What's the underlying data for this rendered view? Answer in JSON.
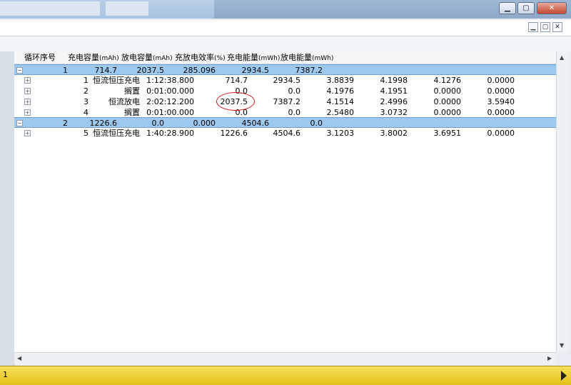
{
  "header": {
    "cycle": "循环序号",
    "charge_cap": "充电容量",
    "charge_cap_unit": "(mAh)",
    "discharge_cap": "放电容量",
    "discharge_cap_unit": "(mAh)",
    "efficiency": "充放电效率",
    "efficiency_unit": "(%)",
    "charge_energy": "充电能量",
    "charge_energy_unit": "(mWh)",
    "discharge_energy": "放电能量",
    "discharge_energy_unit": "(mWh)"
  },
  "groups": [
    {
      "expander": "−",
      "cycle": "1",
      "charge_cap": "714.7",
      "discharge_cap": "2037.5",
      "efficiency": "285.096",
      "charge_energy": "2934.5",
      "discharge_energy": "7387.2",
      "steps": [
        {
          "step": "1",
          "name": "恒流恒压充电",
          "time": "1:12:38.800",
          "v1": "714.7",
          "v2": "2934.5",
          "v3": "3.8839",
          "v4": "4.1998",
          "v5": "4.1276",
          "v6": "0.0000"
        },
        {
          "step": "2",
          "name": "搁置",
          "time": "0:01:00.000",
          "v1": "0.0",
          "v2": "0.0",
          "v3": "4.1976",
          "v4": "4.1951",
          "v5": "0.0000",
          "v6": "0.0000"
        },
        {
          "step": "3",
          "name": "恒流放电",
          "time": "2:02:12.200",
          "v1": "2037.5",
          "v2": "7387.2",
          "v3": "4.1514",
          "v4": "2.4996",
          "v5": "0.0000",
          "v6": "3.5940"
        },
        {
          "step": "4",
          "name": "搁置",
          "time": "0:01:00.000",
          "v1": "0.0",
          "v2": "0.0",
          "v3": "2.5480",
          "v4": "3.0732",
          "v5": "0.0000",
          "v6": "0.0000"
        }
      ]
    },
    {
      "expander": "−",
      "cycle": "2",
      "charge_cap": "1226.6",
      "discharge_cap": "0.0",
      "efficiency": "0.000",
      "charge_energy": "4504.6",
      "discharge_energy": "0.0",
      "steps": [
        {
          "step": "5",
          "name": "恒流恒压充电",
          "time": "1:40:28.900",
          "v1": "1226.6",
          "v2": "4504.6",
          "v3": "3.1203",
          "v4": "3.8002",
          "v5": "3.6951",
          "v6": "0.0000"
        }
      ]
    }
  ],
  "status": {
    "text": "1"
  },
  "window": {
    "min": "▁",
    "max": "▢",
    "close": "✕"
  },
  "colors": {
    "group_row": "#9ec9ef",
    "status_bar": "#e8cb2a",
    "highlight": "#d41c1c"
  }
}
